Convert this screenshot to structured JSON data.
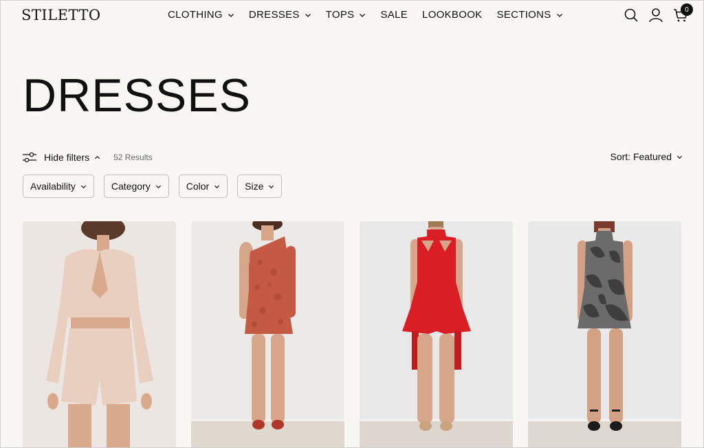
{
  "header": {
    "logo": "STILETTO",
    "nav": [
      {
        "label": "CLOTHING",
        "has_dropdown": true
      },
      {
        "label": "DRESSES",
        "has_dropdown": true
      },
      {
        "label": "TOPS",
        "has_dropdown": true
      },
      {
        "label": "SALE",
        "has_dropdown": false
      },
      {
        "label": "LOOKBOOK",
        "has_dropdown": false
      },
      {
        "label": "SECTIONS",
        "has_dropdown": true
      }
    ],
    "icons": [
      "search-icon",
      "account-icon",
      "cart-icon"
    ],
    "cart_count": "0"
  },
  "page": {
    "title": "DRESSES"
  },
  "toolbar": {
    "hide_filters_label": "Hide filters",
    "results": "52 Results",
    "sort_label": "Sort: Featured"
  },
  "filters": [
    {
      "label": "Availability"
    },
    {
      "label": "Category"
    },
    {
      "label": "Color"
    },
    {
      "label": "Size"
    }
  ],
  "products": [
    {
      "outfit_color": "#e8cfc0",
      "outfit_style": "satin-crop-set"
    },
    {
      "outfit_color": "#c45a44",
      "outfit_style": "one-shoulder-lace-dress"
    },
    {
      "outfit_color": "#d91f25",
      "outfit_style": "halter-cutout-dress"
    },
    {
      "outfit_color": "#6b6b6b",
      "outfit_style": "printed-halter-dress"
    }
  ],
  "colors": {
    "background": "#f8f7f3",
    "text": "#111111",
    "muted": "#666666",
    "border": "#bdbdbd"
  }
}
